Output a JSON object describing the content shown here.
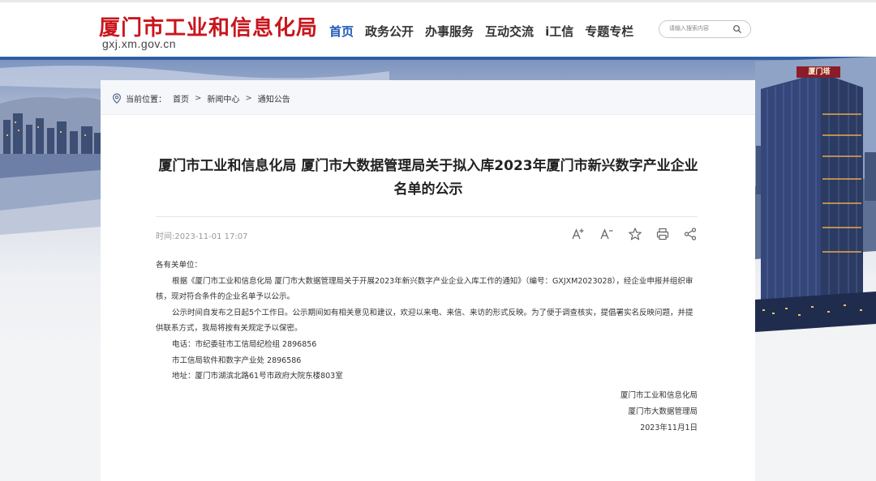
{
  "header": {
    "site_title": "厦门市工业和信息化局",
    "domain": "gxj.xm.gov.cn",
    "nav": [
      {
        "label": "首页",
        "active": true
      },
      {
        "label": "政务公开",
        "active": false
      },
      {
        "label": "办事服务",
        "active": false
      },
      {
        "label": "互动交流",
        "active": false
      },
      {
        "label": "i工信",
        "active": false
      },
      {
        "label": "专题专栏",
        "active": false
      }
    ],
    "search": {
      "placeholder": "请输入搜索内容",
      "icon": "search-icon"
    }
  },
  "banner": {
    "building_sign": "厦门塔"
  },
  "breadcrumb": {
    "prefix": "当前位置：",
    "items": [
      "首页",
      "新闻中心",
      "通知公告"
    ],
    "separator": ">"
  },
  "article": {
    "title": "厦门市工业和信息化局 厦门市大数据管理局关于拟入库2023年厦门市新兴数字产业企业名单的公示",
    "date": "时间:2023-11-01 17:07",
    "tools": [
      "font-increase-icon",
      "font-decrease-icon",
      "star-icon",
      "print-icon",
      "share-icon"
    ],
    "salutation": "各有关单位：",
    "paragraphs": [
      "根据《厦门市工业和信息化局 厦门市大数据管理局关于开展2023年新兴数字产业企业入库工作的通知》（编号：GXJXM2023028），经企业申报并组织审核，现对符合条件的企业名单予以公示。",
      "公示时间自发布之日起5个工作日。公示期间如有相关意见和建议，欢迎以来电、来信、来访的形式反映。为了便于调查核实，提倡署实名反映问题，并提供联系方式，我局将按有关规定予以保密。",
      "电话：市纪委驻市工信局纪检组 2896856",
      "市工信局软件和数字产业处 2896586",
      "地址：厦门市湖滨北路61号市政府大院东楼803室"
    ],
    "signature": [
      "厦门市工业和信息化局",
      "厦门市大数据管理局",
      "2023年11月1日"
    ]
  },
  "colors": {
    "brand_red": "#c8161d",
    "nav_active": "#1f5ab8",
    "banner_stripe": "#2f5fa5"
  }
}
